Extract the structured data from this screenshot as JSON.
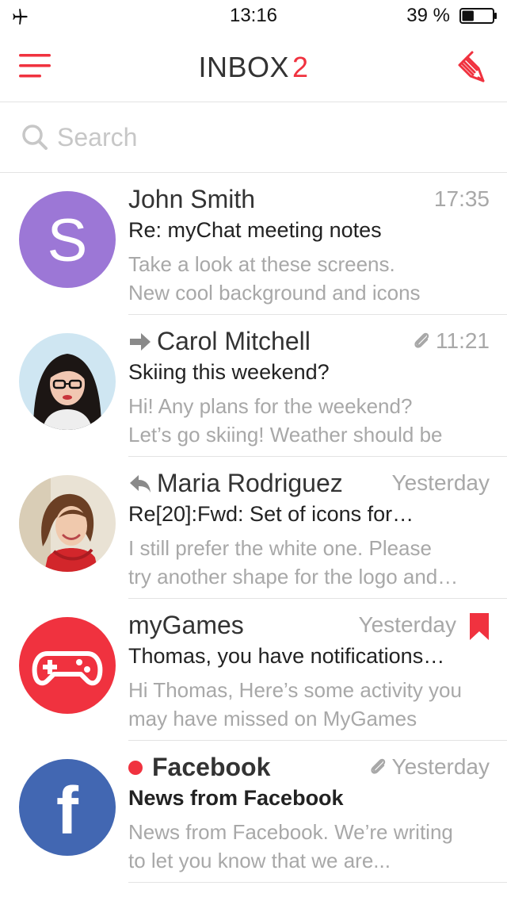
{
  "status_bar": {
    "time": "13:16",
    "battery_percent": "39 %",
    "battery_level": 0.39,
    "icons": [
      "airplane-icon",
      "battery-icon"
    ]
  },
  "header": {
    "title": "INBOX",
    "unread_count": "2",
    "icons": [
      "menu-icon",
      "compose-icon"
    ]
  },
  "search": {
    "placeholder": "Search",
    "value": ""
  },
  "colors": {
    "accent": "#f0323f",
    "text": "#333333",
    "muted": "#a8a8a8",
    "divider": "#e3e3e3",
    "avatar_purple": "#9c77d6",
    "mygames_red": "#f0323f",
    "facebook_blue": "#4267b2"
  },
  "messages": [
    {
      "sender": "John Smith",
      "avatar_letter": "S",
      "time": "17:35",
      "subject": "Re: myChat meeting notes",
      "preview_line1": "Take a look at these screens.",
      "preview_line2": "New cool background and icons",
      "unread": false,
      "attachment": false,
      "direction": "none",
      "flagged": false
    },
    {
      "sender": "Carol Mitchell",
      "time": "11:21",
      "subject": "Skiing this weekend?",
      "preview_line1": "Hi! Any plans for the weekend?",
      "preview_line2": "Let’s go skiing! Weather should be",
      "unread": false,
      "attachment": true,
      "direction": "forwarded",
      "flagged": false
    },
    {
      "sender": "Maria Rodriguez",
      "time": "Yesterday",
      "subject": "Re[20]:Fwd:  Set of icons for…",
      "preview_line1": "I still prefer the white one. Please",
      "preview_line2": "try another shape for the logo and…",
      "unread": false,
      "attachment": false,
      "direction": "replied",
      "flagged": false
    },
    {
      "sender": "myGames",
      "time": "Yesterday",
      "subject": "Thomas, you have notifications…",
      "preview_line1": "Hi Thomas, Here’s some activity you",
      "preview_line2": "may have missed on MyGames",
      "unread": false,
      "attachment": false,
      "direction": "none",
      "flagged": true
    },
    {
      "sender": "Facebook",
      "avatar_letter": "f",
      "time": "Yesterday",
      "subject": "News from Facebook",
      "preview_line1": "News from Facebook. We’re writing",
      "preview_line2": "to let you know that we are...",
      "unread": true,
      "attachment": true,
      "direction": "none",
      "flagged": false
    }
  ]
}
